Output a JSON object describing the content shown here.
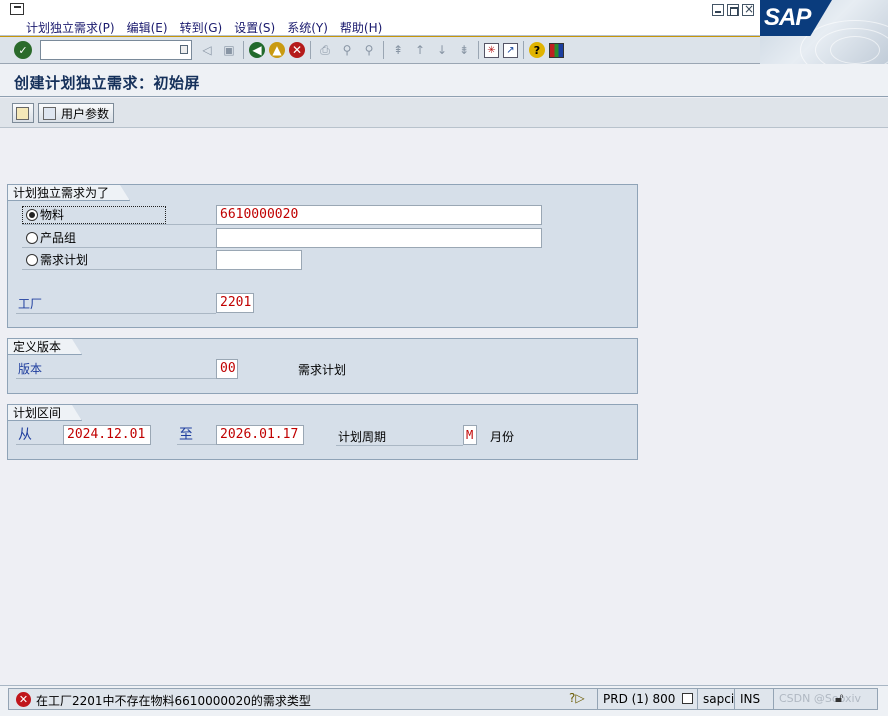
{
  "menu": {
    "items": [
      "计划独立需求(P)",
      "编辑(E)",
      "转到(G)",
      "设置(S)",
      "系统(Y)",
      "帮助(H)"
    ]
  },
  "brand": {
    "logo": "SAP",
    "accent": "#0a3c7d"
  },
  "toolbar": {
    "command_value": "",
    "icons": [
      "enter-icon",
      "command-dropdown-icon",
      "back-nav-icon",
      "save-icon",
      "back-icon",
      "exit-icon",
      "cancel-icon",
      "print-icon",
      "find-icon",
      "find-next-icon",
      "first-page-icon",
      "prev-page-icon",
      "next-page-icon",
      "last-page-icon",
      "create-session-icon",
      "shortcut-icon",
      "help-icon",
      "layout-icon"
    ]
  },
  "page": {
    "title": "创建计划独立需求：初始屏"
  },
  "app_toolbar": {
    "user_params_label": "用户参数"
  },
  "group1": {
    "title": "计划独立需求为了",
    "material_label": "物料",
    "material_value": "6610000020",
    "material_selected": true,
    "product_group_label": "产品组",
    "product_group_value": "",
    "req_plan_label": "需求计划",
    "req_plan_value": "",
    "plant_label": "工厂",
    "plant_value": "2201"
  },
  "group2": {
    "title": "定义版本",
    "version_label": "版本",
    "version_value": "00",
    "version_text": "需求计划"
  },
  "group3": {
    "title": "计划区间",
    "from_label": "从",
    "from_value": "2024.12.01",
    "to_label": "至",
    "to_value": "2026.01.17",
    "period_label": "计划周期",
    "period_value": "M",
    "period_text": "月份"
  },
  "status": {
    "type": "error",
    "message": "在工厂2201中不存在物料6610000020的需求类型",
    "system": "PRD (1) 800",
    "server": "sapci",
    "mode": "INS",
    "watermark": "CSDN @Sooxiv"
  }
}
